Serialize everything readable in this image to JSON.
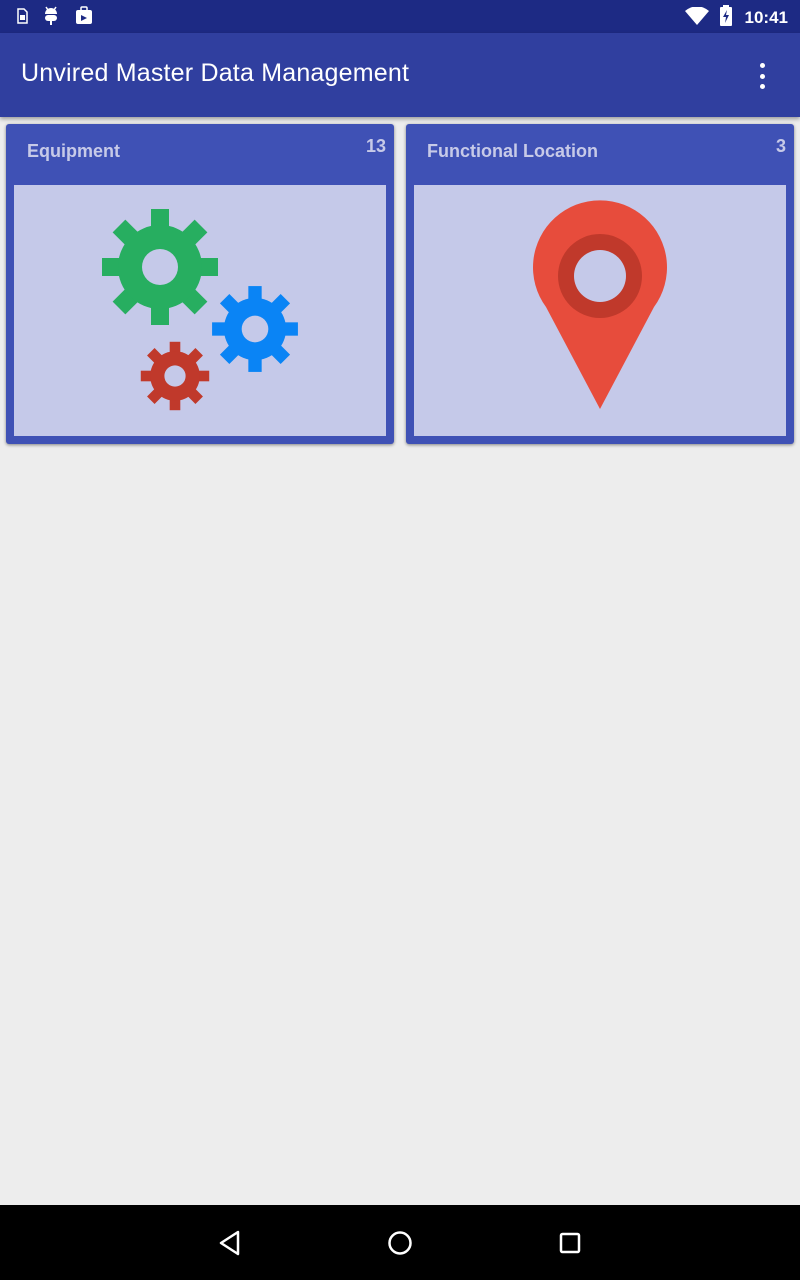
{
  "status_bar": {
    "time": "10:41",
    "icons": [
      "sim-card-icon",
      "android-debug-icon",
      "clipboard-icon",
      "wifi-icon",
      "battery-charging-icon"
    ]
  },
  "app_bar": {
    "title": "Unvired Master Data Management",
    "menu_icon": "more-vert-icon"
  },
  "tiles": [
    {
      "title": "Equipment",
      "count": "13",
      "icon": "gears-icon",
      "colors": {
        "gear_large": "#27ae60",
        "gear_medium": "#0a84f5",
        "gear_small": "#c0392b"
      }
    },
    {
      "title": "Functional Location",
      "count": "3",
      "icon": "map-pin-icon",
      "colors": {
        "pin": "#e74c3c",
        "pin_ring": "#c0392b",
        "pin_hole": "#c5c9e9"
      }
    }
  ],
  "nav_bar": {
    "buttons": [
      "back-icon",
      "home-icon",
      "recents-icon"
    ]
  },
  "colors": {
    "status_bar": "#1d2a84",
    "app_bar": "#303f9f",
    "tile": "#3f51b5",
    "tile_image_bg": "#c5c9e9",
    "background": "#ededed",
    "nav_bar": "#000000"
  }
}
